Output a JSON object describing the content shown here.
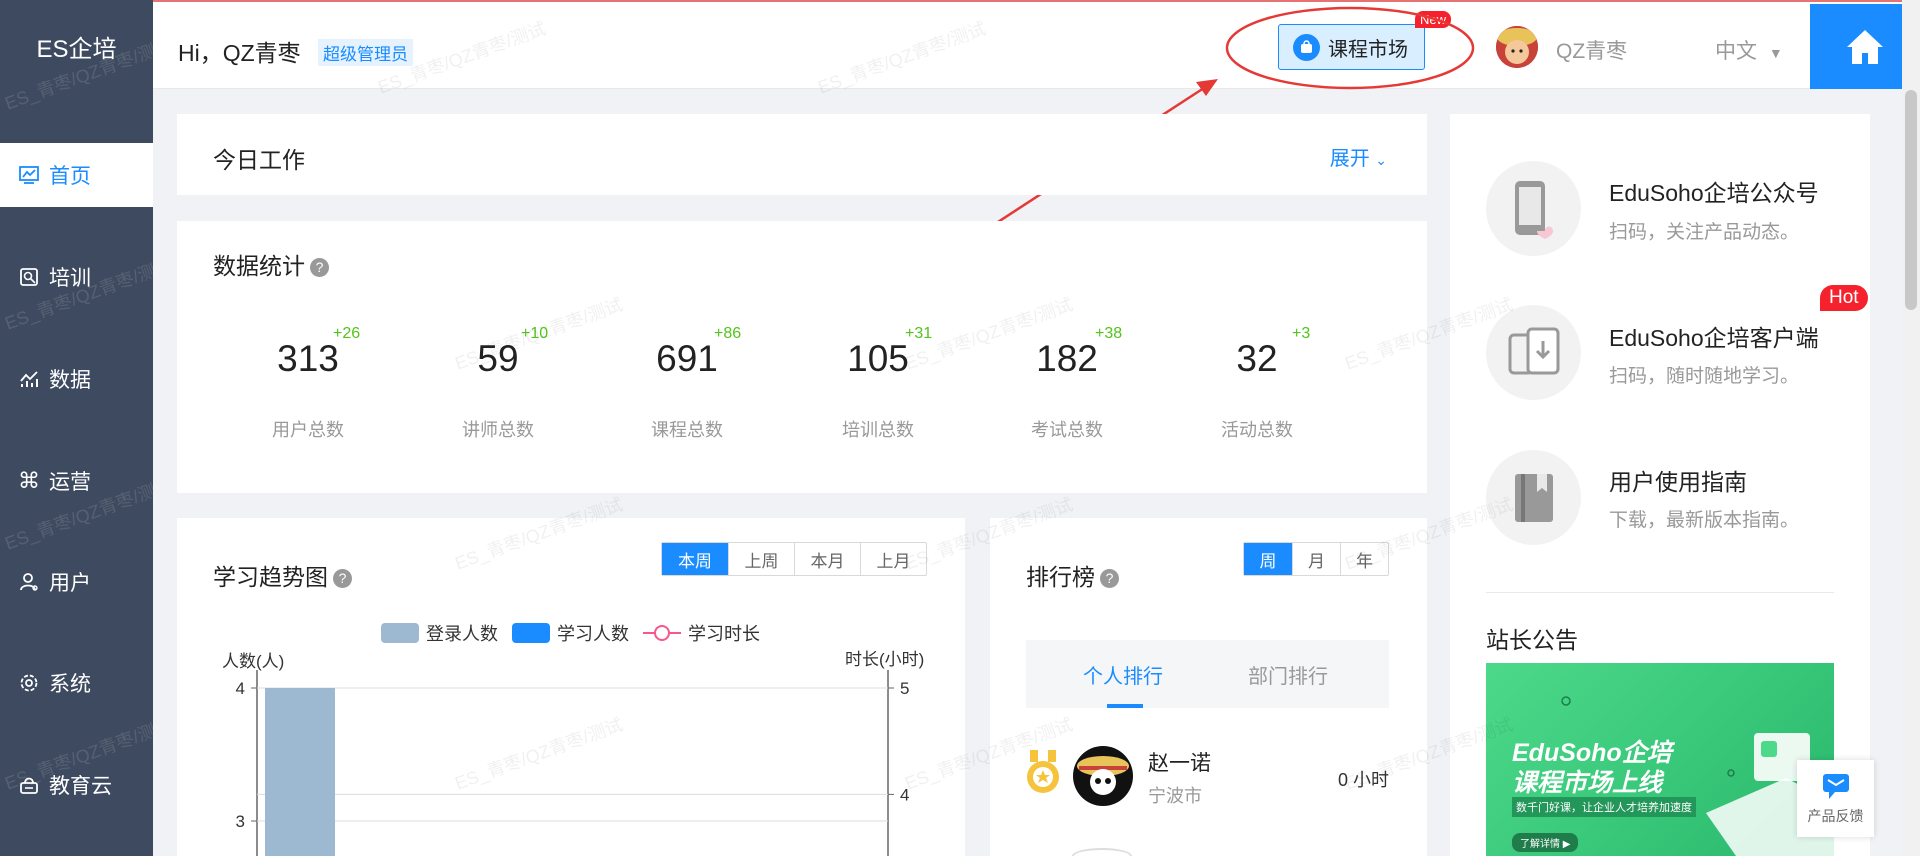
{
  "sidebar": {
    "logo": "ES企培",
    "items": [
      {
        "label": "首页",
        "icon": "chart-line-icon"
      },
      {
        "label": "培训",
        "icon": "training-icon"
      },
      {
        "label": "数据",
        "icon": "data-icon"
      },
      {
        "label": "运营",
        "icon": "command-icon"
      },
      {
        "label": "用户",
        "icon": "user-icon"
      },
      {
        "label": "系统",
        "icon": "gear-icon"
      },
      {
        "label": "教育云",
        "icon": "cloud-icon"
      }
    ],
    "watermark": "ES_青枣/QZ青枣/测试"
  },
  "header": {
    "greeting": "Hi，QZ青枣",
    "role": "超级管理员",
    "market_label": "课程市场",
    "new_badge": "New",
    "username": "QZ青枣",
    "language": "中文"
  },
  "today": {
    "title": "今日工作",
    "expand_label": "展开"
  },
  "stats": {
    "title": "数据统计",
    "items": [
      {
        "value": "313",
        "increase": "+26",
        "label": "用户总数"
      },
      {
        "value": "59",
        "increase": "+10",
        "label": "讲师总数"
      },
      {
        "value": "691",
        "increase": "+86",
        "label": "课程总数"
      },
      {
        "value": "105",
        "increase": "+31",
        "label": "培训总数"
      },
      {
        "value": "182",
        "increase": "+38",
        "label": "考试总数"
      },
      {
        "value": "32",
        "increase": "+3",
        "label": "活动总数"
      }
    ]
  },
  "trend": {
    "title": "学习趋势图",
    "periods": [
      "本周",
      "上周",
      "本月",
      "上月"
    ],
    "active_period": "本周",
    "legend": [
      "登录人数",
      "学习人数",
      "学习时长"
    ],
    "left_axis_label": "人数(人)",
    "right_axis_label": "时长(小时)"
  },
  "chart_data": {
    "type": "bar",
    "categories": [
      ""
    ],
    "series": [
      {
        "name": "登录人数",
        "values": [
          4
        ]
      },
      {
        "name": "学习人数",
        "values": [
          0
        ]
      },
      {
        "name": "学习时长",
        "values": [
          0
        ]
      }
    ],
    "xlabel": "",
    "ylabel": "人数(人)",
    "y2label": "时长(小时)",
    "left_ticks": [
      4,
      3
    ],
    "right_ticks": [
      5,
      4
    ],
    "colors": {
      "login": "#9db9d2",
      "study": "#1a8cff",
      "duration": "#f5588b"
    }
  },
  "ranking": {
    "title": "排行榜",
    "periods": [
      "周",
      "月",
      "年"
    ],
    "active_period": "周",
    "tabs": [
      "个人排行",
      "部门排行"
    ],
    "active_tab": "个人排行",
    "entries": [
      {
        "name": "赵一诺",
        "city": "宁波市",
        "hours": "0 小时"
      }
    ]
  },
  "right_panel": {
    "items": [
      {
        "title": "EduSoho企培公众号",
        "desc": "扫码，关注产品动态。",
        "icon": "phone-icon"
      },
      {
        "title": "EduSoho企培客户端",
        "desc": "扫码，随时随地学习。",
        "icon": "devices-icon"
      },
      {
        "title": "用户使用指南",
        "desc": "下载，最新版本指南。",
        "icon": "book-icon"
      }
    ],
    "hot_badge": "Hot",
    "announcement_title": "站长公告",
    "promo_title": "EduSoho企培",
    "promo_subtitle": "课程市场上线",
    "promo_text": "数千门好课，让企业人才培养加速度",
    "promo_button": "了解详情 ▶"
  },
  "feedback_label": "产品反馈"
}
